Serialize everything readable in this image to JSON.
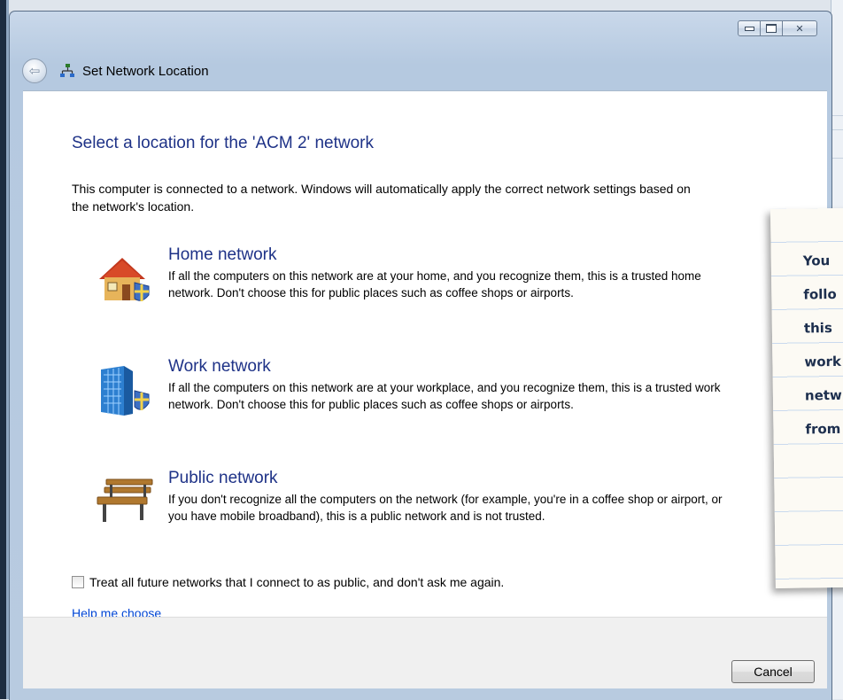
{
  "window": {
    "title": "Set Network Location",
    "caption_buttons": [
      "minimize",
      "maximize",
      "close"
    ]
  },
  "main": {
    "heading": "Select a location for the 'ACM  2' network",
    "intro": "This computer is connected to a network. Windows will automatically apply the correct network settings based on the network's location.",
    "options": [
      {
        "title": "Home network",
        "icon": "home-network-icon",
        "description": "If all the computers on this network are at your home, and you recognize them, this is a trusted home network.  Don't choose this for public places such as coffee shops or airports."
      },
      {
        "title": "Work network",
        "icon": "work-network-icon",
        "description": "If all the computers on this network are at your workplace, and you recognize them, this is a trusted work network.  Don't choose this for public places such as coffee shops or airports."
      },
      {
        "title": "Public network",
        "icon": "public-network-icon",
        "description": "If you don't recognize all the computers on the network (for example, you're in a coffee shop or airport, or you have mobile broadband), this is a public network and is not trusted."
      }
    ],
    "checkbox_label": "Treat all future networks that I connect to as public, and don't ask me again.",
    "checkbox_checked": false,
    "help_link": "Help me choose"
  },
  "footer": {
    "cancel_label": "Cancel"
  },
  "note": {
    "lines": [
      "You",
      "follo",
      "this",
      "work",
      "netw",
      "from"
    ]
  },
  "colors": {
    "heading": "#1e3287",
    "link": "#0046d5",
    "frame": "#b8cbe0"
  }
}
